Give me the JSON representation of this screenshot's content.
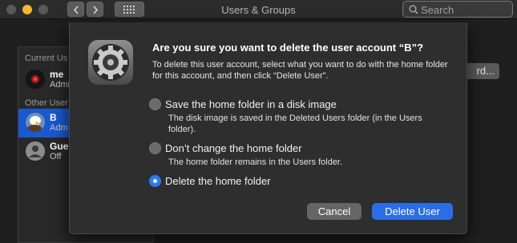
{
  "window": {
    "title": "Users & Groups"
  },
  "toolbar": {
    "back_icon": "chevron-left-icon",
    "forward_icon": "chevron-right-icon",
    "grid_icon": "grid-icon"
  },
  "search": {
    "placeholder": "Search"
  },
  "sidebar": {
    "current_heading": "Current Us",
    "current_users": [
      {
        "name": "me",
        "role": "Admi"
      }
    ],
    "other_heading": "Other User",
    "other_users": [
      {
        "name": "B",
        "role": "Adm",
        "selected": true
      },
      {
        "name": "Gue",
        "role": "Off",
        "selected": false
      }
    ]
  },
  "background_button": {
    "label": "rd..."
  },
  "dialog": {
    "icon": "gear-icon",
    "title": "Are you sure you want to delete the user account “B”?",
    "description": "To delete this user account, select what you want to do with the home folder for this account, and then click “Delete User”.",
    "options": [
      {
        "label": "Save the home folder in a disk image",
        "help": "The disk image is saved in the Deleted Users folder (in the Users folder).",
        "selected": false
      },
      {
        "label": "Don’t change the home folder",
        "help": "The home folder remains in the Users folder.",
        "selected": false
      },
      {
        "label": "Delete the home folder",
        "help": "",
        "selected": true
      }
    ],
    "cancel_label": "Cancel",
    "confirm_label": "Delete User"
  },
  "colors": {
    "accent": "#2a6ee6",
    "selection": "#1a58d0",
    "dialog_bg": "#2e2e2e",
    "minimize_light": "#f2b830"
  }
}
